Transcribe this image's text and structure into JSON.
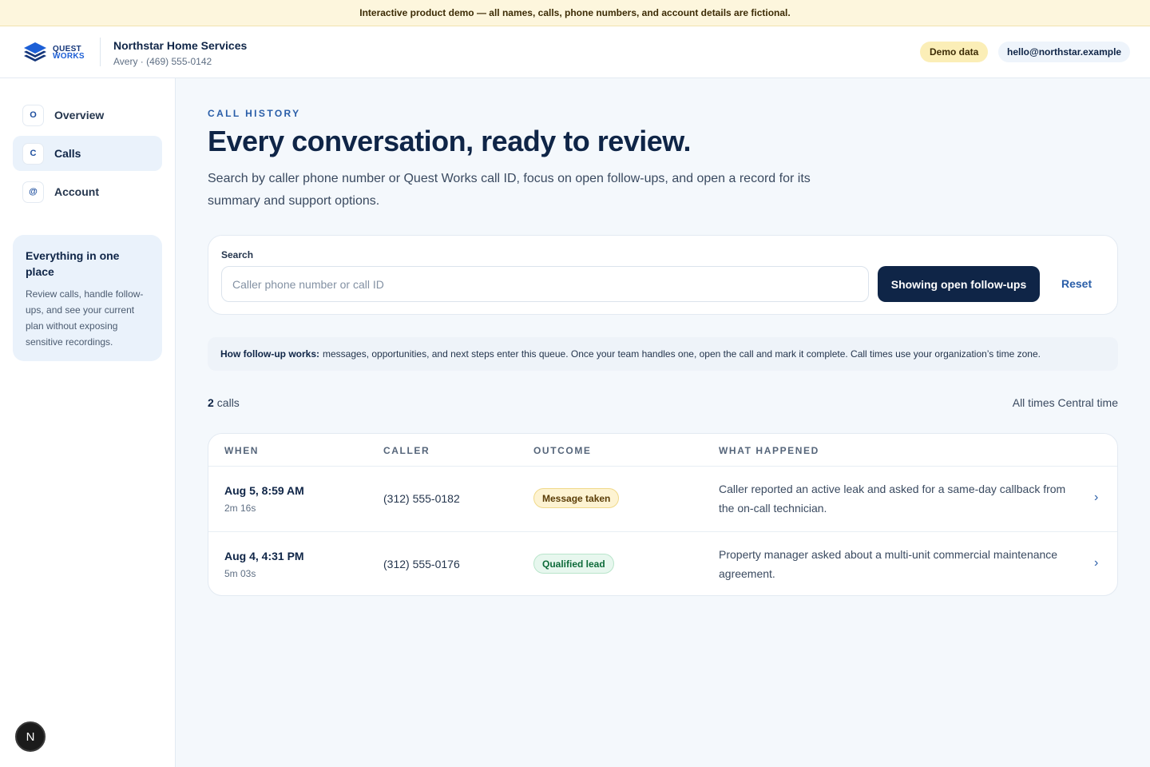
{
  "banner": {
    "text": "Interactive product demo — all names, calls, phone numbers, and account details are fictional."
  },
  "header": {
    "logo": {
      "line1": "QUEST",
      "line2": "WORKS",
      "icon": "stacked-layers-icon"
    },
    "org_name": "Northstar Home Services",
    "org_sub": "Avery · (469) 555-0142",
    "demo_badge": "Demo data",
    "email": "hello@northstar.example"
  },
  "sidebar": {
    "items": [
      {
        "icon": "O",
        "label": "Overview",
        "active": false
      },
      {
        "icon": "C",
        "label": "Calls",
        "active": true
      },
      {
        "icon": "@",
        "label": "Account",
        "active": false
      }
    ],
    "promo": {
      "title": "Everything in one place",
      "body": "Review calls, handle follow-ups, and see your current plan without exposing sensitive recordings."
    },
    "avatar": "N"
  },
  "main": {
    "eyebrow": "CALL HISTORY",
    "headline": "Every conversation, ready to review.",
    "lede": "Search by caller phone number or Quest Works call ID, focus on open follow-ups, and open a record for its summary and support options.",
    "search": {
      "label": "Search",
      "placeholder": "Caller phone number or call ID",
      "value": "",
      "filter_button": "Showing open follow-ups",
      "reset": "Reset"
    },
    "note": {
      "bold": "How follow-up works:",
      "text": "messages, opportunities, and next steps enter this queue. Once your team handles one, open the call and mark it complete. Call times use your organization’s time zone."
    },
    "count": {
      "number": "2",
      "label": "calls"
    },
    "timezone": "All times Central time",
    "table": {
      "columns": [
        "WHEN",
        "CALLER",
        "OUTCOME",
        "WHAT HAPPENED"
      ],
      "rows": [
        {
          "when": "Aug 5, 8:59 AM",
          "duration": "2m 16s",
          "caller": "(312) 555-0182",
          "outcome": "Message taken",
          "summary": "Caller reported an active leak and asked for a same-day callback from the on-call technician.",
          "chevron": "›"
        },
        {
          "when": "Aug 4, 4:31 PM",
          "duration": "5m 03s",
          "caller": "(312) 555-0176",
          "outcome": "Qualified lead",
          "summary": "Property manager asked about a multi-unit commercial maintenance agreement.",
          "chevron": "›"
        }
      ]
    }
  },
  "colors": {
    "navy": "#0f2547",
    "accent_blue": "#2a5ea8",
    "banner_bg": "#fdf6dd",
    "badge_amber": "#fdf3d2",
    "badge_green": "#e7f7ee"
  }
}
